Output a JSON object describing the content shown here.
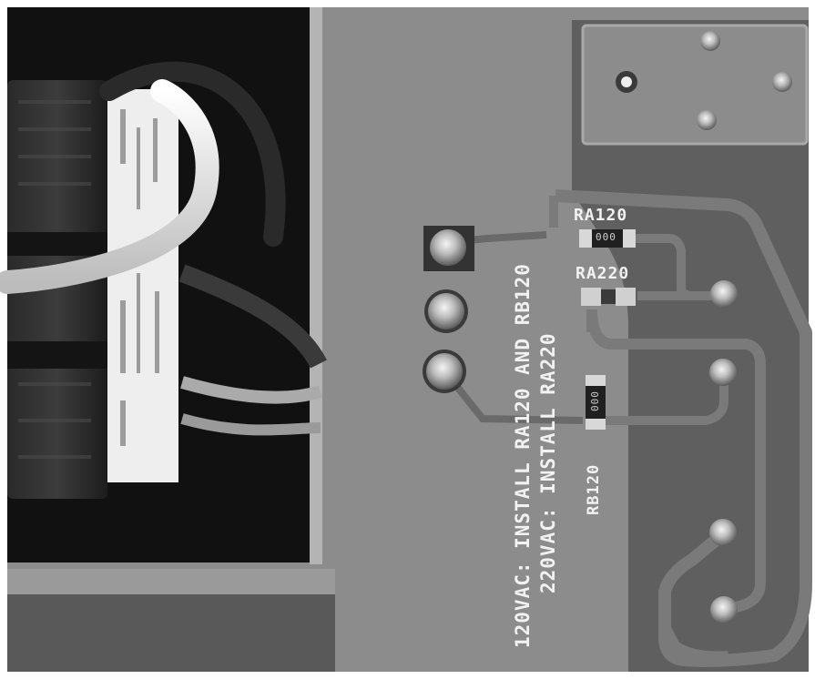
{
  "pcb_labels": {
    "instruction_line_1": "120VAC: INSTALL RA120 AND RB120",
    "instruction_line_2": "220VAC: INSTALL RA220",
    "ra120": "RA120",
    "ra220": "RA220",
    "rb120": "RB120"
  },
  "component_markings": {
    "ra120_code": "000",
    "rb120_code": "000"
  },
  "colors": {
    "board": "#8c8c8c",
    "board_light": "#a0a0a0",
    "copper_pour": "#5d5d5d",
    "trace": "#787878",
    "silkscreen": "#f2f2f2",
    "enclosure": "#111111"
  }
}
